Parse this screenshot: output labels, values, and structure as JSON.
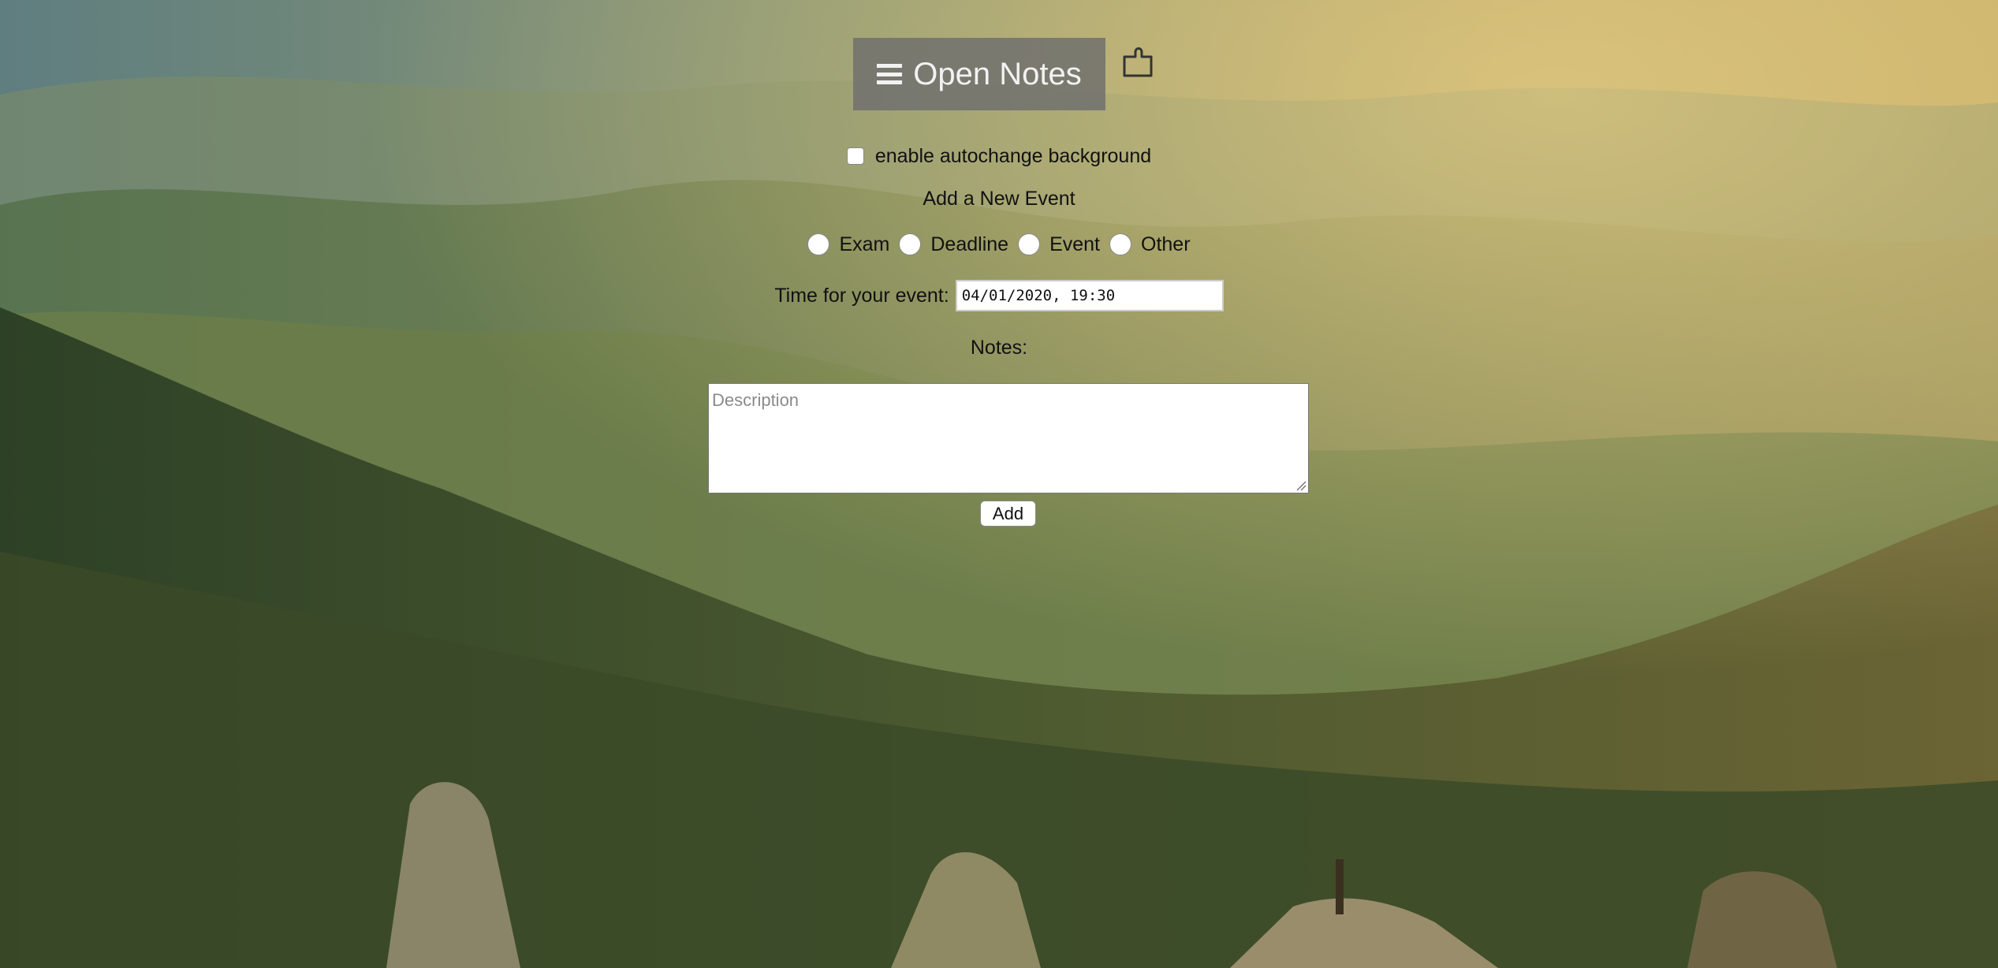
{
  "header": {
    "open_notes_label": "Open Notes",
    "menu_icon": "hamburger-icon",
    "extension_icon": "puzzle-icon"
  },
  "settings": {
    "autochange_label": "enable autochange background",
    "autochange_checked": false
  },
  "form": {
    "title": "Add a New Event",
    "event_types": [
      "Exam",
      "Deadline",
      "Event",
      "Other"
    ],
    "time_label": "Time for your event:",
    "time_value": "04/01/2020, 19:30",
    "notes_label": "Notes:",
    "notes_placeholder": "Description",
    "add_label": "Add"
  },
  "colors": {
    "button_bg": "#6e6e6e",
    "button_text": "#f2f2f2"
  }
}
